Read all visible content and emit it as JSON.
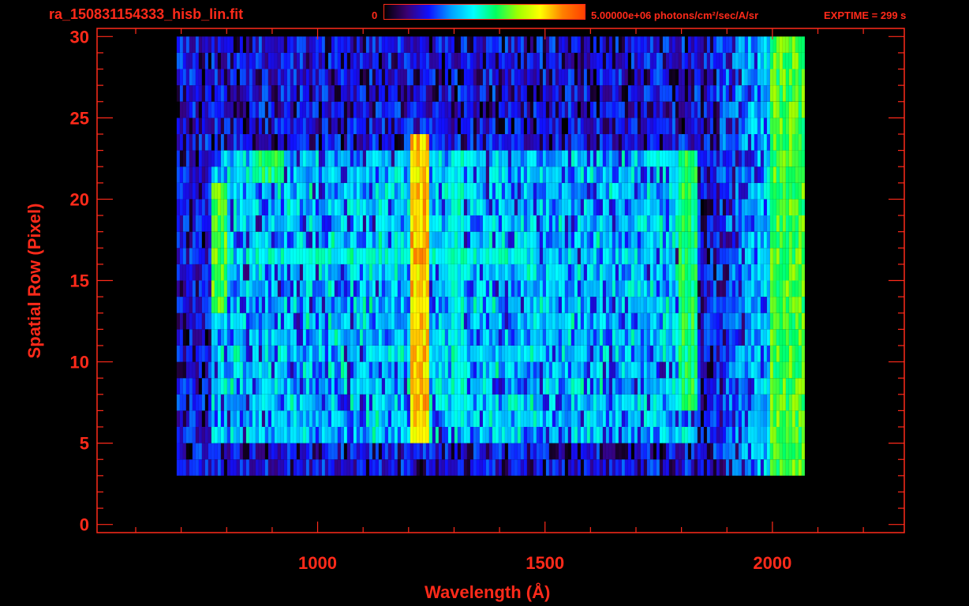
{
  "header": {
    "file_title": "ra_150831154333_hisb_lin.fit",
    "colorbar_min": "0",
    "colorbar_max": "5.00000e+06 photons/cm²/sec/A/sr",
    "exptime": "EXPTIME = 299 s"
  },
  "colors": {
    "axis": "#ff2a1a",
    "background": "#000000",
    "colormap": [
      "#000000",
      "#3a0070",
      "#1010ff",
      "#00a0ff",
      "#00ffff",
      "#00ff60",
      "#a0ff00",
      "#ffff00",
      "#ff8000",
      "#ff0000"
    ]
  },
  "chart_data": {
    "type": "heatmap",
    "title": "ra_150831154333_hisb_lin.fit",
    "xlabel": "Wavelength (Å)",
    "ylabel": "Spatial Row (Pixel)",
    "xlim": [
      515,
      2290
    ],
    "ylim": [
      -0.5,
      30.5
    ],
    "x_ticks": [
      1000,
      1500,
      2000
    ],
    "y_ticks": [
      0,
      5,
      10,
      15,
      20,
      25,
      30
    ],
    "colorbar": {
      "min": 0,
      "max": 5000000,
      "unit": "photons/cm²/sec/A/sr"
    },
    "detector_extent": {
      "x": [
        690,
        2070
      ],
      "y": [
        3,
        30
      ]
    },
    "signal_region": {
      "x": [
        760,
        1830
      ],
      "y": [
        5,
        23
      ]
    },
    "features": [
      {
        "x": [
          1200,
          1240
        ],
        "y": [
          5,
          24
        ],
        "level": 0.82
      },
      {
        "x": [
          1790,
          1830
        ],
        "y": [
          7,
          23
        ],
        "level": 0.55
      },
      {
        "x": [
          1990,
          2070
        ],
        "y": [
          2,
          30
        ],
        "level": 0.6
      },
      {
        "x": [
          760,
          800
        ],
        "y": [
          13,
          21
        ],
        "level": 0.6
      },
      {
        "x": [
          850,
          920
        ],
        "y": [
          21,
          23
        ],
        "level": 0.55
      },
      {
        "x": [
          840,
          1460
        ],
        "y": [
          16,
          17
        ],
        "level": 0.45
      },
      {
        "x": [
          1290,
          1320
        ],
        "y": [
          6,
          23
        ],
        "level": 0.45
      },
      {
        "x": [
          1120,
          1500
        ],
        "y": [
          10,
          11
        ],
        "level": 0.38
      }
    ]
  }
}
